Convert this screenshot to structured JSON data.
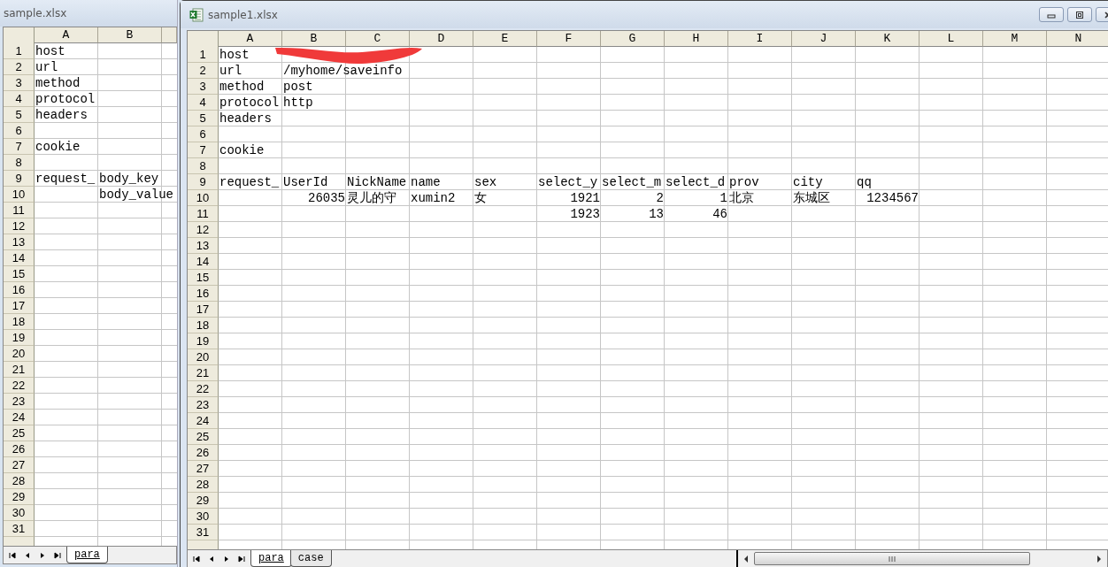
{
  "windows": [
    {
      "kind": "back",
      "title": "sample.xlsx",
      "columns": [
        "A",
        "B"
      ],
      "rows": [
        {
          "n": "1",
          "cells": [
            "host"
          ]
        },
        {
          "n": "2",
          "cells": [
            "url"
          ]
        },
        {
          "n": "3",
          "cells": [
            "method"
          ]
        },
        {
          "n": "4",
          "cells": [
            "protocol"
          ]
        },
        {
          "n": "5",
          "cells": [
            "headers"
          ]
        },
        {
          "n": "6",
          "cells": []
        },
        {
          "n": "7",
          "cells": [
            "cookie"
          ]
        },
        {
          "n": "8",
          "cells": []
        },
        {
          "n": "9",
          "cells": [
            "request_",
            "body_key"
          ]
        },
        {
          "n": "10",
          "cells": [
            null,
            "body_value"
          ]
        },
        {
          "n": "11",
          "cells": []
        },
        {
          "n": "12",
          "cells": []
        },
        {
          "n": "13",
          "cells": []
        },
        {
          "n": "14",
          "cells": []
        },
        {
          "n": "15",
          "cells": []
        },
        {
          "n": "16",
          "cells": []
        },
        {
          "n": "17",
          "cells": []
        },
        {
          "n": "18",
          "cells": []
        },
        {
          "n": "19",
          "cells": []
        },
        {
          "n": "20",
          "cells": []
        },
        {
          "n": "21",
          "cells": []
        },
        {
          "n": "22",
          "cells": []
        },
        {
          "n": "23",
          "cells": []
        },
        {
          "n": "24",
          "cells": []
        },
        {
          "n": "25",
          "cells": []
        },
        {
          "n": "26",
          "cells": []
        },
        {
          "n": "27",
          "cells": []
        },
        {
          "n": "28",
          "cells": []
        },
        {
          "n": "29",
          "cells": []
        },
        {
          "n": "30",
          "cells": []
        },
        {
          "n": "31",
          "cells": []
        }
      ],
      "sheets": [
        {
          "label": "para",
          "selected": true
        }
      ]
    },
    {
      "kind": "front",
      "title": "sample1.xlsx",
      "columns": [
        "A",
        "B",
        "C",
        "D",
        "E",
        "F",
        "G",
        "H",
        "I",
        "J",
        "K",
        "L",
        "M",
        "N"
      ],
      "rows": [
        {
          "n": "1",
          "cells": [
            "host",
            {
              "kind": "redacted"
            }
          ]
        },
        {
          "n": "2",
          "cells": [
            "url",
            "/myhome/saveinfo"
          ]
        },
        {
          "n": "3",
          "cells": [
            "method",
            "post"
          ]
        },
        {
          "n": "4",
          "cells": [
            "protocol",
            "http"
          ]
        },
        {
          "n": "5",
          "cells": [
            "headers"
          ]
        },
        {
          "n": "6",
          "cells": []
        },
        {
          "n": "7",
          "cells": [
            "cookie"
          ]
        },
        {
          "n": "8",
          "cells": []
        },
        {
          "n": "9",
          "cells": [
            "request_",
            "UserId",
            "NickName",
            "name",
            "sex",
            "select_y",
            "select_m",
            "select_d",
            "prov",
            "city",
            "qq"
          ]
        },
        {
          "n": "10",
          "cells": [
            null,
            {
              "kind": "number",
              "text": "26035"
            },
            "灵儿的守",
            "xumin2",
            "女",
            {
              "kind": "number",
              "text": "1921"
            },
            {
              "kind": "number",
              "text": "2"
            },
            {
              "kind": "number",
              "text": "1"
            },
            "北京",
            "东城区",
            {
              "kind": "number",
              "text": "1234567"
            }
          ]
        },
        {
          "n": "11",
          "cells": [
            null,
            null,
            null,
            null,
            null,
            {
              "kind": "number",
              "text": "1923"
            },
            {
              "kind": "number",
              "text": "13"
            },
            {
              "kind": "number",
              "text": "46"
            }
          ]
        },
        {
          "n": "12",
          "cells": []
        },
        {
          "n": "13",
          "cells": []
        },
        {
          "n": "14",
          "cells": []
        },
        {
          "n": "15",
          "cells": []
        },
        {
          "n": "16",
          "cells": []
        },
        {
          "n": "17",
          "cells": []
        },
        {
          "n": "18",
          "cells": []
        },
        {
          "n": "19",
          "cells": []
        },
        {
          "n": "20",
          "cells": []
        },
        {
          "n": "21",
          "cells": []
        },
        {
          "n": "22",
          "cells": []
        },
        {
          "n": "23",
          "cells": []
        },
        {
          "n": "24",
          "cells": []
        },
        {
          "n": "25",
          "cells": []
        },
        {
          "n": "26",
          "cells": []
        },
        {
          "n": "27",
          "cells": []
        },
        {
          "n": "28",
          "cells": []
        },
        {
          "n": "29",
          "cells": []
        },
        {
          "n": "30",
          "cells": []
        },
        {
          "n": "31",
          "cells": []
        }
      ],
      "sheets": [
        {
          "label": "para",
          "selected": true
        },
        {
          "label": "case",
          "selected": false
        }
      ]
    }
  ]
}
